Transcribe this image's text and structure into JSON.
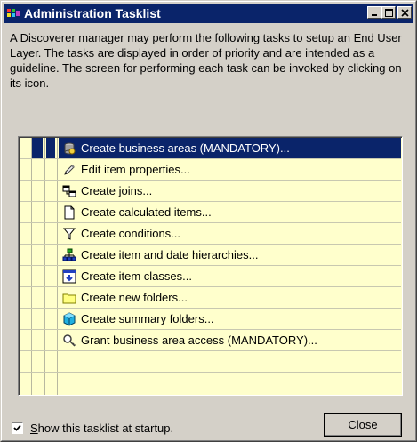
{
  "window": {
    "title": "Administration Tasklist"
  },
  "description": "A Discoverer manager may perform the following tasks to setup an End User Layer. The tasks are displayed in order of priority and are intended as a guideline. The screen for performing each task can be invoked by clicking on its icon.",
  "tasks": [
    {
      "label": "Create business areas (MANDATORY)...",
      "icon": "business-area-icon",
      "selected": true
    },
    {
      "label": "Edit item properties...",
      "icon": "pencil-icon"
    },
    {
      "label": "Create joins...",
      "icon": "joins-icon"
    },
    {
      "label": "Create calculated items...",
      "icon": "document-icon"
    },
    {
      "label": "Create conditions...",
      "icon": "funnel-icon"
    },
    {
      "label": "Create item and date hierarchies...",
      "icon": "hierarchy-icon"
    },
    {
      "label": "Create item classes...",
      "icon": "item-class-icon"
    },
    {
      "label": "Create new folders...",
      "icon": "folder-icon"
    },
    {
      "label": "Create summary folders...",
      "icon": "cube-icon"
    },
    {
      "label": "Grant business area access (MANDATORY)...",
      "icon": "key-magnifier-icon"
    }
  ],
  "footer": {
    "show_at_startup_label": "how this tasklist at startup.",
    "show_at_startup_mnemonic": "S",
    "show_at_startup_checked": true,
    "close_label": "Close"
  },
  "colors": {
    "titlebar": "#0a246a",
    "list_background": "#ffffcc",
    "face": "#d4d0c8"
  }
}
